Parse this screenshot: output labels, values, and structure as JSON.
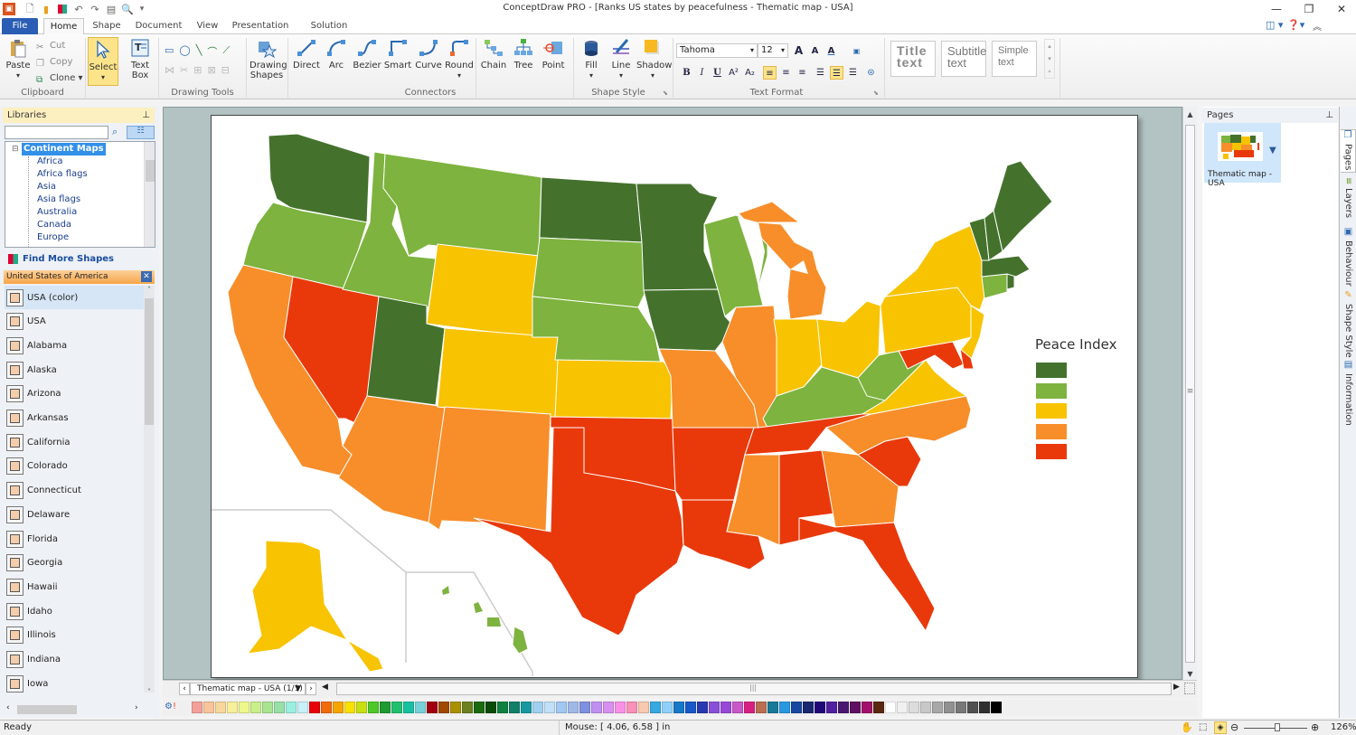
{
  "window": {
    "title": "ConceptDraw PRO - [Ranks US states by peacefulness - Thematic map - USA]",
    "controls": {
      "minimize": "—",
      "restore": "❐",
      "close": "✕"
    }
  },
  "quick_access": [
    "app-icon",
    "new-document-icon",
    "open-icon",
    "solution-park-icon",
    "undo-icon",
    "redo-icon",
    "save-icon",
    "print-preview-icon",
    "customize-icon"
  ],
  "tabs": [
    {
      "label": "File"
    },
    {
      "label": "Home"
    },
    {
      "label": "Shape"
    },
    {
      "label": "Document"
    },
    {
      "label": "View"
    },
    {
      "label": "Presentation"
    },
    {
      "label": "Solution Park"
    }
  ],
  "ribbon": {
    "clipboard": {
      "paste": "Paste",
      "cut": "Cut",
      "copy": "Copy",
      "clone": "Clone",
      "group": "Clipboard"
    },
    "select": "Select",
    "text_box": "Text Box",
    "drawing_tools_group": "Drawing Tools",
    "drawing_shapes": "Drawing Shapes",
    "connectors": {
      "direct": "Direct",
      "arc": "Arc",
      "bezier": "Bezier",
      "smart": "Smart",
      "curve": "Curve",
      "round": "Round",
      "chain": "Chain",
      "tree": "Tree",
      "point": "Point",
      "group": "Connectors"
    },
    "shape_style": {
      "fill": "Fill",
      "line": "Line",
      "shadow": "Shadow",
      "group": "Shape Style"
    },
    "text_format": {
      "font": "Tahoma",
      "size": "12",
      "group": "Text Format",
      "bold": "B",
      "italic": "I",
      "underline": "U",
      "superscript": "A²",
      "subscript": "A₂",
      "grow": "A˄",
      "shrink": "A˅",
      "color": "A"
    },
    "text_styles": [
      {
        "line1": "Title",
        "line2": "text"
      },
      {
        "line1": "Subtitle",
        "line2": "text"
      },
      {
        "line1": "Simple",
        "line2": "text"
      }
    ]
  },
  "libraries": {
    "title": "Libraries",
    "search_placeholder": "",
    "tree_root": "Continent Maps",
    "tree_items": [
      "Africa",
      "Africa flags",
      "Asia",
      "Asia flags",
      "Australia",
      "Canada",
      "Europe"
    ],
    "find_more": "Find More Shapes",
    "open_library": "United States of America",
    "shapes": [
      "USA (color)",
      "USA",
      "Alabama",
      "Alaska",
      "Arizona",
      "Arkansas",
      "California",
      "Colorado",
      "Connecticut",
      "Delaware",
      "Florida",
      "Georgia",
      "Hawaii",
      "Idaho",
      "Illinois",
      "Indiana",
      "Iowa"
    ]
  },
  "map": {
    "legend_title": "Peace Index",
    "legend_colors": [
      "#44722d",
      "#7db33e",
      "#f8c300",
      "#f78e2a",
      "#e9390b"
    ],
    "levels": {
      "1": [
        "WA",
        "ND",
        "MN",
        "IA",
        "UT",
        "ME",
        "NH",
        "VT",
        "MA",
        "RI"
      ],
      "2": [
        "OR",
        "ID",
        "MT",
        "SD",
        "NE",
        "WI",
        "KY",
        "WV",
        "CT",
        "HI"
      ],
      "3": [
        "WY",
        "CO",
        "KS",
        "IN",
        "OH",
        "PA",
        "NY",
        "NJ",
        "VA",
        "AK"
      ],
      "4": [
        "CA",
        "AZ",
        "NM",
        "MO",
        "IL",
        "MI",
        "NC",
        "MS",
        "GA"
      ],
      "5": [
        "NV",
        "TX",
        "OK",
        "AR",
        "LA",
        "TN",
        "AL",
        "FL",
        "SC",
        "MD",
        "DE"
      ]
    }
  },
  "pagebar": {
    "page_tab": "Thematic map - USA (1/1)"
  },
  "palette": [
    "#f4a09a",
    "#f8c59a",
    "#f8d79a",
    "#f7ef9a",
    "#eef78a",
    "#c8ef8a",
    "#a8e490",
    "#98e0a8",
    "#9af0e0",
    "#c8f0f8",
    "#e8000a",
    "#f26a0c",
    "#f6a500",
    "#f8e000",
    "#c8e010",
    "#4ec828",
    "#1e9a30",
    "#20c070",
    "#18c0a0",
    "#78d0d8",
    "#a00010",
    "#a04800",
    "#a89000",
    "#6c8020",
    "#1c6a10",
    "#0a4a0a",
    "#108040",
    "#108068",
    "#1898a0",
    "#a0d0f0",
    "#c0e0f8",
    "#a0c8f0",
    "#a0b8e8",
    "#8090e0",
    "#c090f0",
    "#d890f0",
    "#f890e8",
    "#f890b8",
    "#f8c8b0",
    "#38a8e0",
    "#90d0f8",
    "#1878c8",
    "#1858c8",
    "#2838b0",
    "#8850d8",
    "#9848d8",
    "#c858c8",
    "#d82080",
    "#b87050",
    "#187898",
    "#2898e0",
    "#1848a0",
    "#182870",
    "#200878",
    "#5020a0",
    "#481870",
    "#601060",
    "#a01068",
    "#5a2810",
    "#ffffff",
    "#f0f0f0",
    "#dcdcdc",
    "#c8c8c8",
    "#a8a8a8",
    "#909090",
    "#787878",
    "#505050",
    "#303030",
    "#000000"
  ],
  "pages_panel": {
    "title": "Pages",
    "page_name": "Thematic map - USA"
  },
  "side_tabs": [
    "Pages",
    "Layers",
    "Behaviour",
    "Shape Style",
    "Information"
  ],
  "status": {
    "left": "Ready",
    "mouse": "Mouse: [ 4.06, 6.58 ] in",
    "zoom": "126%",
    "zoom_fraction": 0.53
  }
}
